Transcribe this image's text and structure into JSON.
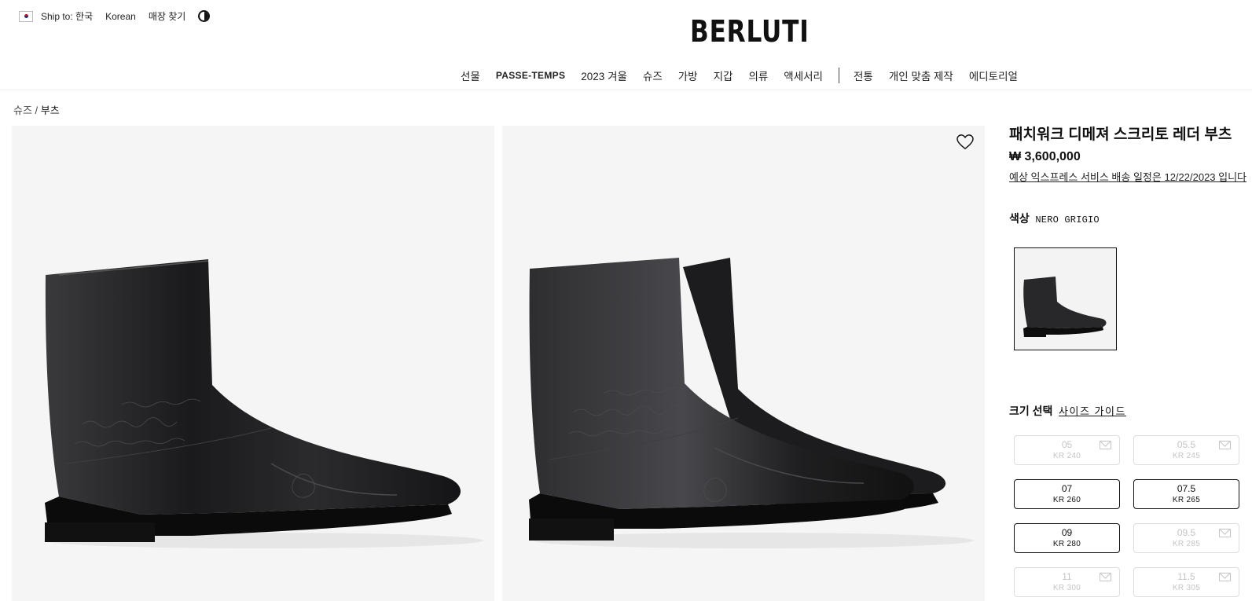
{
  "utility": {
    "ship_to": "Ship to: 한국",
    "language": "Korean",
    "store_locator": "매장 찾기"
  },
  "brand": {
    "logo": "BERLUTI"
  },
  "nav": {
    "items": [
      "선물",
      "PASSE-TEMPS",
      "2023 겨울",
      "슈즈",
      "가방",
      "지갑",
      "의류",
      "액세서리"
    ],
    "items_after_divider": [
      "전통",
      "개인 맞춤 제작",
      "에디토리얼"
    ]
  },
  "breadcrumb": {
    "parent": "슈즈",
    "separator": " / ",
    "current": "부츠"
  },
  "product": {
    "title": "패치워크 디메져 스크리토 레더 부츠",
    "price": "₩ 3,600,000",
    "delivery": "예상 익스프레스 서비스 배송 일정은 12/22/2023 입니다",
    "color_label": "색상",
    "color_value": "NERO GRIGIO",
    "size_label": "크기 선택",
    "size_guide": "사이즈 가이드"
  },
  "sizes": [
    {
      "eu": "05",
      "kr": "KR 240",
      "available": false
    },
    {
      "eu": "05.5",
      "kr": "KR 245",
      "available": false
    },
    {
      "eu": "07",
      "kr": "KR 260",
      "available": true
    },
    {
      "eu": "07.5",
      "kr": "KR 265",
      "available": true
    },
    {
      "eu": "09",
      "kr": "KR 280",
      "available": true
    },
    {
      "eu": "09.5",
      "kr": "KR 285",
      "available": false
    },
    {
      "eu": "11",
      "kr": "KR 300",
      "available": false
    },
    {
      "eu": "11.5",
      "kr": "KR 305",
      "available": false
    }
  ],
  "icons": {
    "wishlist": "heart-icon",
    "contrast": "contrast-icon",
    "notify": "mail-icon",
    "flag": "korea-flag-icon"
  }
}
